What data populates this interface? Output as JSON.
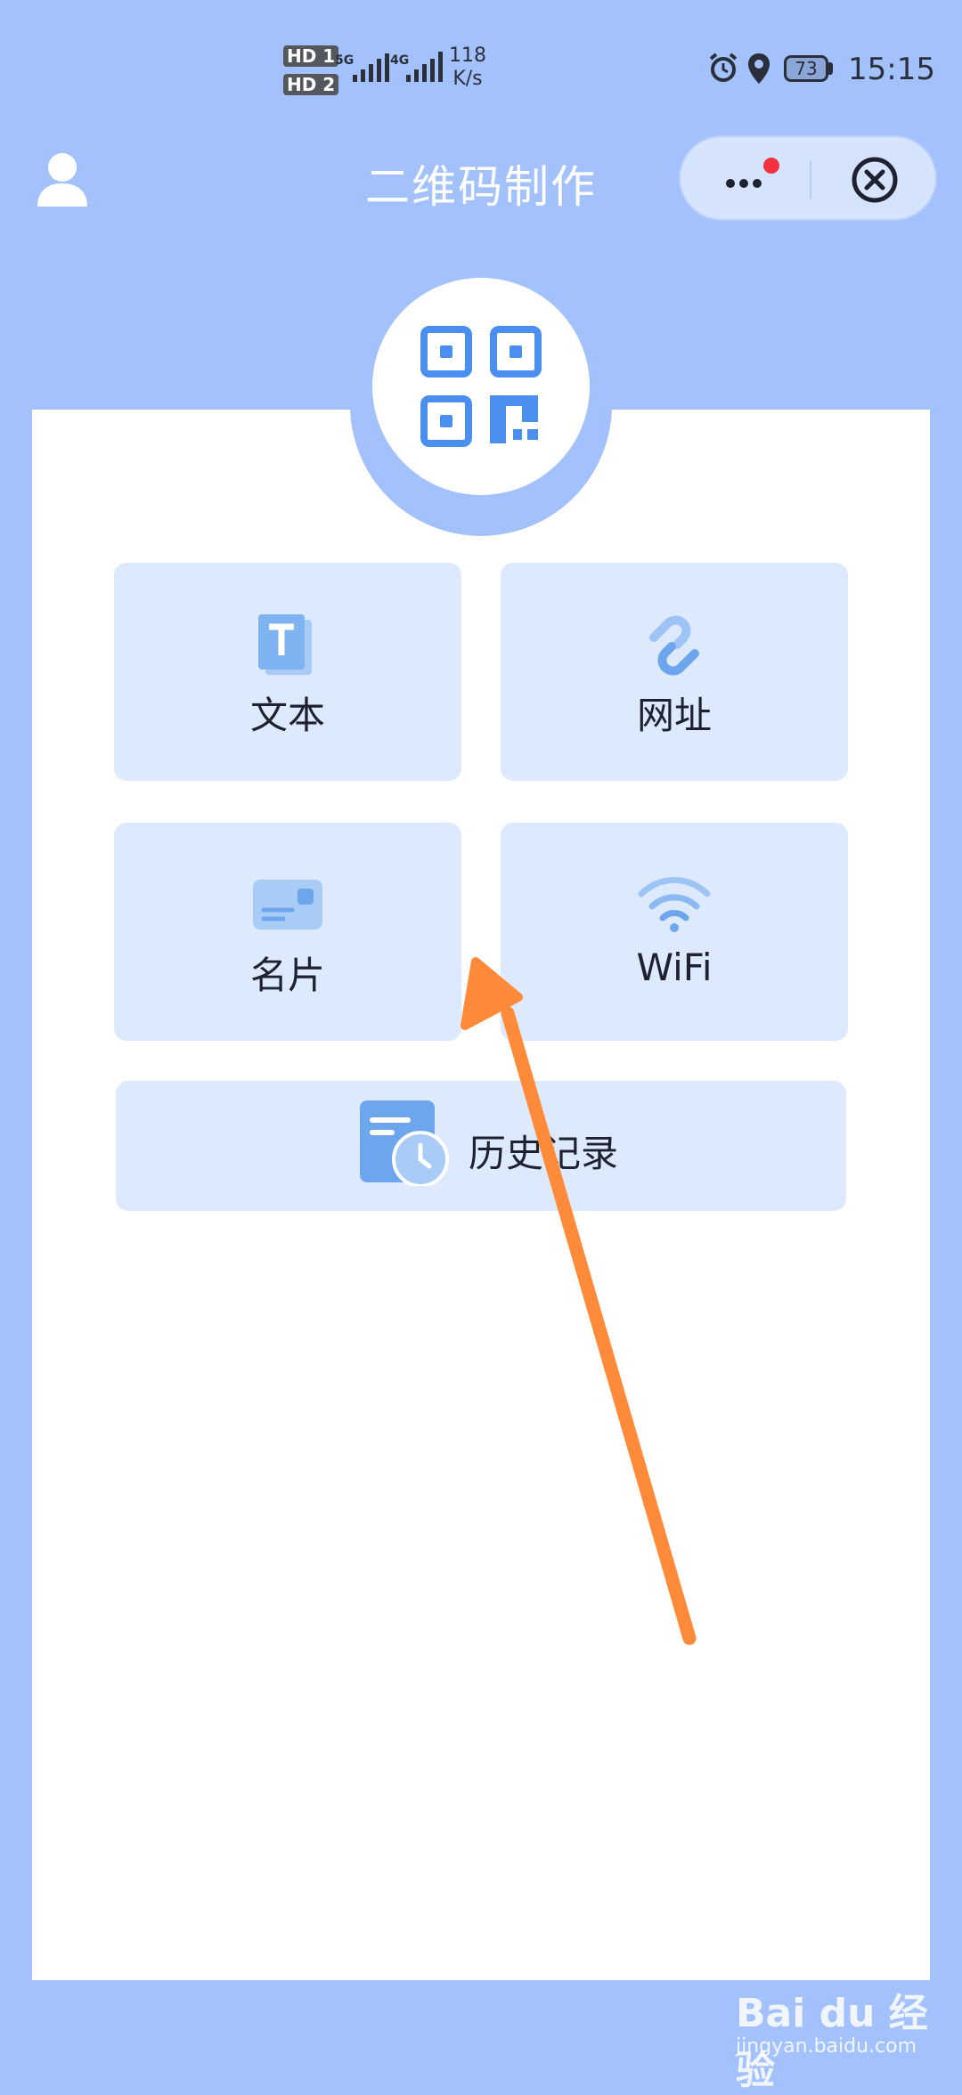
{
  "status_bar": {
    "sim1": "HD 1",
    "sim2": "HD 2",
    "net1": "5G",
    "net2": "4G",
    "speed_value": "118",
    "speed_unit": "K/s",
    "battery": "73",
    "time": "15:15"
  },
  "header": {
    "title": "二维码制作",
    "more_icon": "more-dots-icon",
    "close_icon": "circle-close-icon",
    "user_icon": "user-icon"
  },
  "logo": {
    "icon": "qr-code-icon"
  },
  "menu": {
    "text": {
      "label": "文本",
      "icon": "text-doc-icon"
    },
    "url": {
      "label": "网址",
      "icon": "link-icon"
    },
    "card": {
      "label": "名片",
      "icon": "business-card-icon"
    },
    "wifi": {
      "label": "WiFi",
      "icon": "wifi-icon"
    }
  },
  "history": {
    "label": "历史记录",
    "icon": "history-icon"
  },
  "watermark": {
    "brand": "Bai du 经验",
    "url": "jingyan.baidu.com"
  },
  "colors": {
    "background": "#a3c2fd",
    "tile": "#ddeafd",
    "accent": "#4a8ff0",
    "annotation_arrow": "#ff8a3a",
    "notification_dot": "#f2323f"
  }
}
